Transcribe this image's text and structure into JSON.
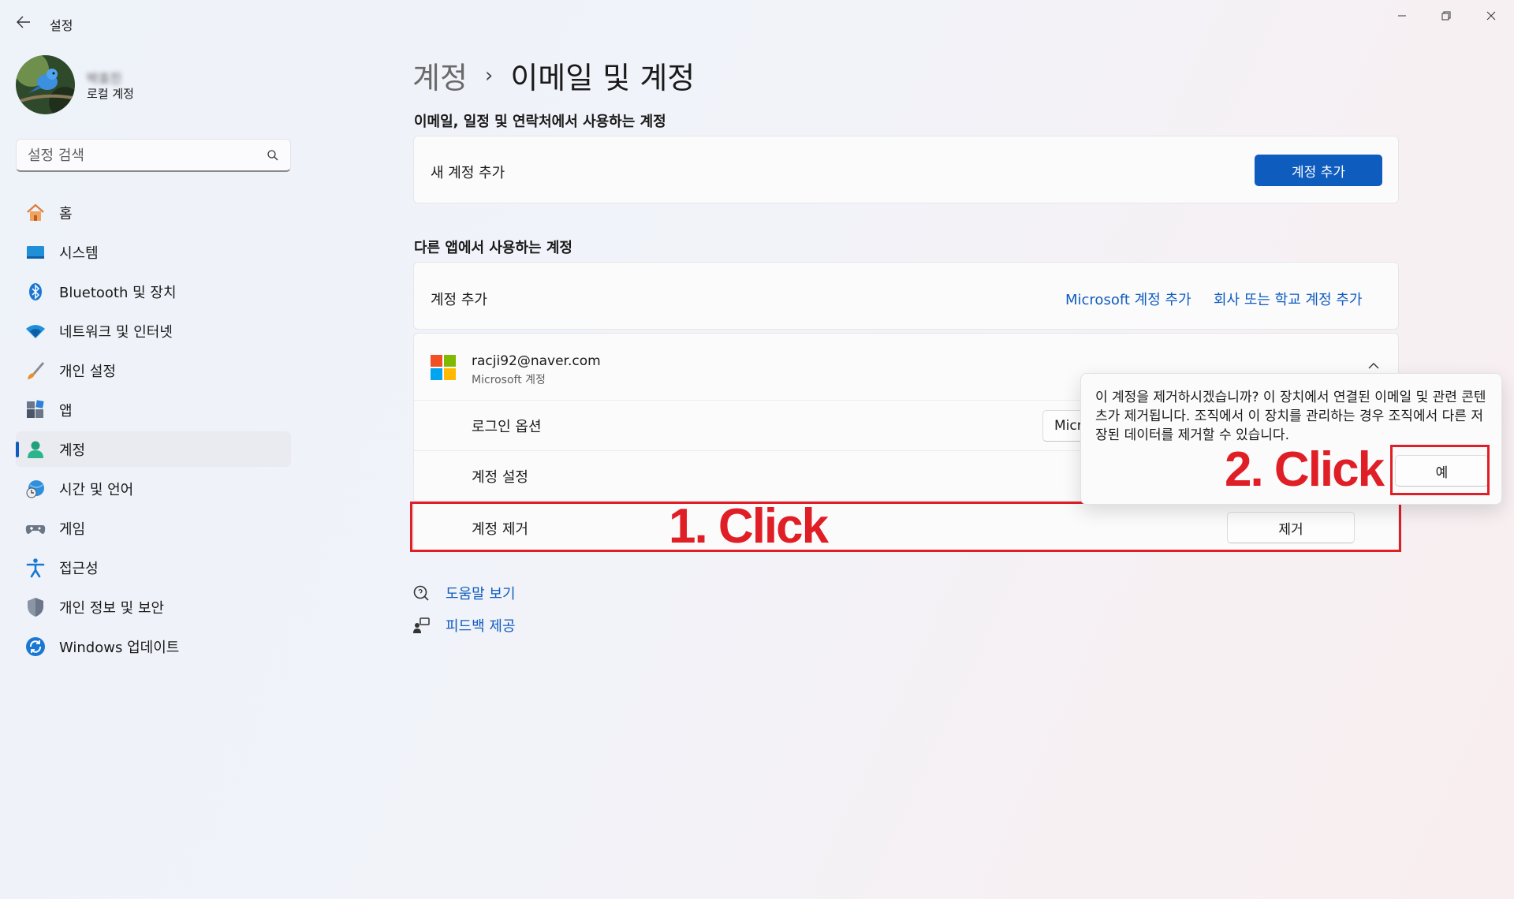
{
  "window": {
    "title": "설정",
    "back_icon": "arrow-left-icon",
    "minimize_icon": "minimize-icon",
    "maximize_icon": "restore-icon",
    "close_icon": "close-icon"
  },
  "profile": {
    "name": "박효진",
    "account_type": "로컬 계정"
  },
  "search": {
    "placeholder": "설정 검색"
  },
  "sidebar": {
    "items": [
      {
        "label": "홈",
        "icon": "home-icon"
      },
      {
        "label": "시스템",
        "icon": "system-icon"
      },
      {
        "label": "Bluetooth 및 장치",
        "icon": "bluetooth-icon"
      },
      {
        "label": "네트워크 및 인터넷",
        "icon": "wifi-icon"
      },
      {
        "label": "개인 설정",
        "icon": "brush-icon"
      },
      {
        "label": "앱",
        "icon": "apps-icon"
      },
      {
        "label": "계정",
        "icon": "account-icon",
        "active": true
      },
      {
        "label": "시간 및 언어",
        "icon": "clock-globe-icon"
      },
      {
        "label": "게임",
        "icon": "gamepad-icon"
      },
      {
        "label": "접근성",
        "icon": "accessibility-icon"
      },
      {
        "label": "개인 정보 및 보안",
        "icon": "shield-icon"
      },
      {
        "label": "Windows 업데이트",
        "icon": "update-icon"
      }
    ]
  },
  "breadcrumb": {
    "parent": "계정",
    "separator": "›",
    "current": "이메일 및 계정"
  },
  "email_section": {
    "title": "이메일, 일정 및 연락처에서 사용하는 계정",
    "row_label": "새 계정 추가",
    "button": "계정 추가"
  },
  "other_apps_section": {
    "title": "다른 앱에서 사용하는 계정",
    "row_label": "계정 추가",
    "link_microsoft": "Microsoft 계정 추가",
    "link_work": "회사 또는 학교 계정 추가"
  },
  "account": {
    "email": "racji92@naver.com",
    "type": "Microsoft 계정",
    "rows": {
      "login_options": "로그인 옵션",
      "login_button_partial": "Micr",
      "account_settings": "계정 설정",
      "remove_label": "계정 제거",
      "remove_button": "제거"
    }
  },
  "flyout": {
    "message": "이 계정을 제거하시겠습니까? 이 장치에서 연결된 이메일 및 관련 콘텐츠가 제거됩니다. 조직에서 이 장치를 관리하는 경우 조직에서 다른 저장된 데이터를 제거할 수 있습니다.",
    "confirm_button": "예"
  },
  "help": {
    "get_help": "도움말 보기",
    "feedback": "피드백 제공"
  },
  "annotations": {
    "step1": "1. Click",
    "step2": "2. Click",
    "color": "#e01e26"
  },
  "colors": {
    "accent": "#0f5cbf"
  }
}
